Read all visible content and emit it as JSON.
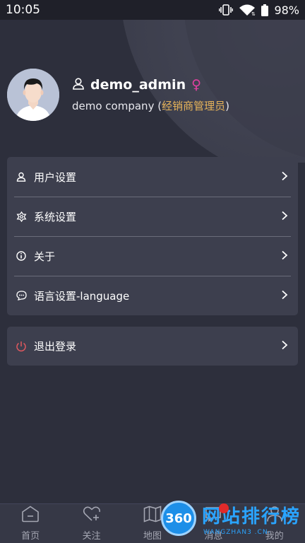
{
  "status": {
    "time": "10:05",
    "battery": "98%"
  },
  "profile": {
    "username": "demo_admin",
    "gender_symbol": "♀",
    "company": "demo company (",
    "role": "经销商管理员",
    "company_close": ")"
  },
  "menu": {
    "items": [
      {
        "label": "用户设置",
        "icon": "user-icon"
      },
      {
        "label": "系统设置",
        "icon": "settings-flower-icon"
      },
      {
        "label": "关于",
        "icon": "info-icon"
      },
      {
        "label": "语言设置-language",
        "icon": "chat-bubble-icon"
      }
    ]
  },
  "logout": {
    "label": "退出登录",
    "icon": "power-icon",
    "color": "#e0585f"
  },
  "bottom_nav": {
    "items": [
      {
        "label": "首页",
        "icon": "home-icon"
      },
      {
        "label": "关注",
        "icon": "heart-plus-icon"
      },
      {
        "label": "地图",
        "icon": "map-icon"
      },
      {
        "label": "消息",
        "icon": "message-icon"
      },
      {
        "label": "我的",
        "icon": "profile-icon"
      }
    ]
  },
  "watermark": {
    "badge": "360",
    "text": "网站排行榜",
    "sub": "WANGZHAN3 .CN-"
  }
}
